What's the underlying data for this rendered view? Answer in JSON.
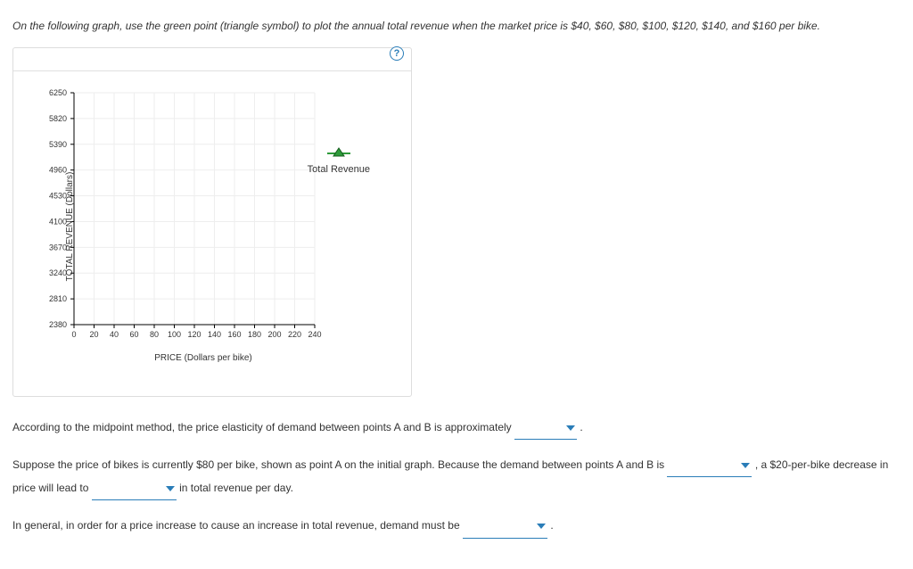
{
  "instructions": "On the following graph, use the green point (triangle symbol) to plot the annual total revenue when the market price is $40, $60, $80, $100, $120, $140, and $160 per bike.",
  "help_label": "?",
  "legend_label": "Total Revenue",
  "chart_data": {
    "type": "scatter",
    "title": "",
    "xlabel": "PRICE (Dollars per bike)",
    "ylabel": "TOTAL REVENUE (Dollars)",
    "xlim": [
      0,
      240
    ],
    "ylim": [
      2380,
      6250
    ],
    "x_ticks": [
      0,
      20,
      40,
      60,
      80,
      100,
      120,
      140,
      160,
      180,
      200,
      220,
      240
    ],
    "y_ticks": [
      2380,
      2810,
      3240,
      3670,
      4100,
      4530,
      4960,
      5390,
      5820,
      6250
    ],
    "series": [
      {
        "name": "Total Revenue",
        "color": "#2e9b3a",
        "symbol": "triangle",
        "x": [],
        "y": []
      }
    ],
    "grid": true
  },
  "q1": {
    "pre": "According to the midpoint method, the price elasticity of demand between points A and B is approximately",
    "post": "."
  },
  "q2": {
    "p1": "Suppose the price of bikes is currently $80 per bike, shown as point A on the initial graph. Because the demand between points A and B is",
    "p2": ", a $20-per-bike decrease in price will lead to",
    "p3": "in total revenue per day."
  },
  "q3": {
    "pre": "In general, in order for a price increase to cause an increase in total revenue, demand must be",
    "post": "."
  }
}
